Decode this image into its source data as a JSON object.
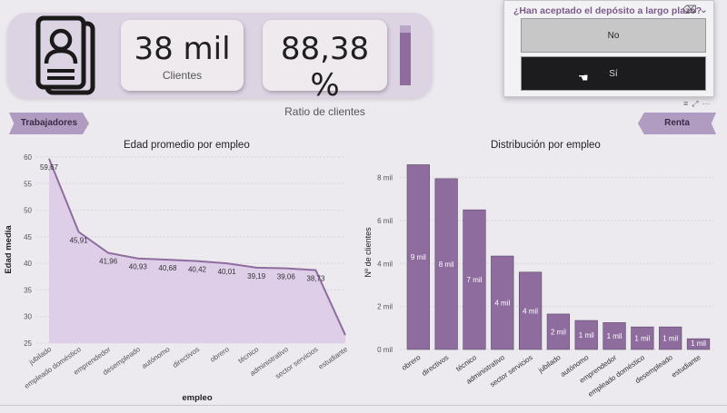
{
  "kpis": {
    "clients_value": "38 mil",
    "clients_label": "Clientes",
    "ratio_value": "88,38 %",
    "ratio_label": "Ratio de clientes",
    "ratio_fraction": 0.8838
  },
  "slicer": {
    "title": "¿Han aceptado el depósito a largo plazo?",
    "options": [
      "No",
      "Sí"
    ],
    "selected": "Sí"
  },
  "nav": {
    "left_label": "Trabajadores",
    "right_label": "Renta"
  },
  "colors": {
    "accent": "#8e6c9e",
    "area_fill": "#dcc9e6",
    "bar": "#8e6c9e"
  },
  "chart_data": [
    {
      "type": "area",
      "title": "Edad promedio por empleo",
      "xlabel": "empleo",
      "ylabel": "Edad media",
      "categories": [
        "jubilado",
        "empleado doméstico",
        "emprendedor",
        "desempleado",
        "autónomo",
        "directivos",
        "obrero",
        "técnico",
        "administrativo",
        "sector servicios",
        "estudiante"
      ],
      "values": [
        59.67,
        45.91,
        41.96,
        40.93,
        40.68,
        40.42,
        40.01,
        39.19,
        39.06,
        38.73,
        26.5
      ],
      "data_labels": [
        "59,67",
        "45,91",
        "41,96",
        "40,93",
        "40,68",
        "40,42",
        "40,01",
        "39,19",
        "39,06",
        "38,73",
        ""
      ],
      "yticks": [
        "25",
        "30",
        "35",
        "40",
        "45",
        "50",
        "55",
        "60"
      ],
      "ylim": [
        25,
        60
      ]
    },
    {
      "type": "bar",
      "title": "Distribución por empleo",
      "xlabel": "",
      "ylabel": "Nº de clientes",
      "categories": [
        "obrero",
        "directivos",
        "técnico",
        "administrativo",
        "sector servicios",
        "jubilado",
        "autónomo",
        "emprendedor",
        "empleado doméstico",
        "desempleado",
        "estudiante"
      ],
      "values": [
        8600,
        7950,
        6500,
        4350,
        3600,
        1650,
        1350,
        1250,
        1050,
        1050,
        500
      ],
      "data_labels": [
        "9 mil",
        "8 mil",
        "7 mil",
        "4 mil",
        "4 mil",
        "2 mil",
        "1 mil",
        "1 mil",
        "1 mil",
        "1 mil",
        "1 mil"
      ],
      "yticks": [
        "0 mil",
        "2 mil",
        "4 mil",
        "6 mil",
        "8 mil"
      ],
      "ylim": [
        0,
        9000
      ]
    }
  ]
}
